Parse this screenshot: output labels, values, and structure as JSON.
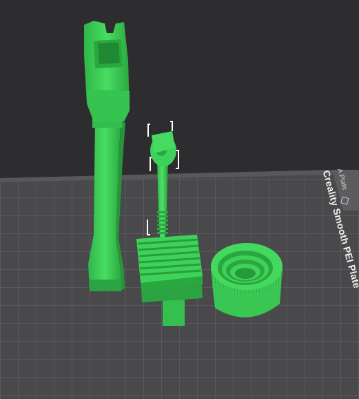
{
  "scene": {
    "plate_name": "Creality Smooth PEI Plate",
    "plate_tab": "A Plate",
    "colors": {
      "background": "#2d2d30",
      "bed": "#4a4a4c",
      "grid": "#6a6a6c",
      "model": "#3fd25a",
      "model_shade": "#2aa83f",
      "selection": "#ffffff"
    },
    "icons": [
      "plate-tab-icon"
    ]
  }
}
